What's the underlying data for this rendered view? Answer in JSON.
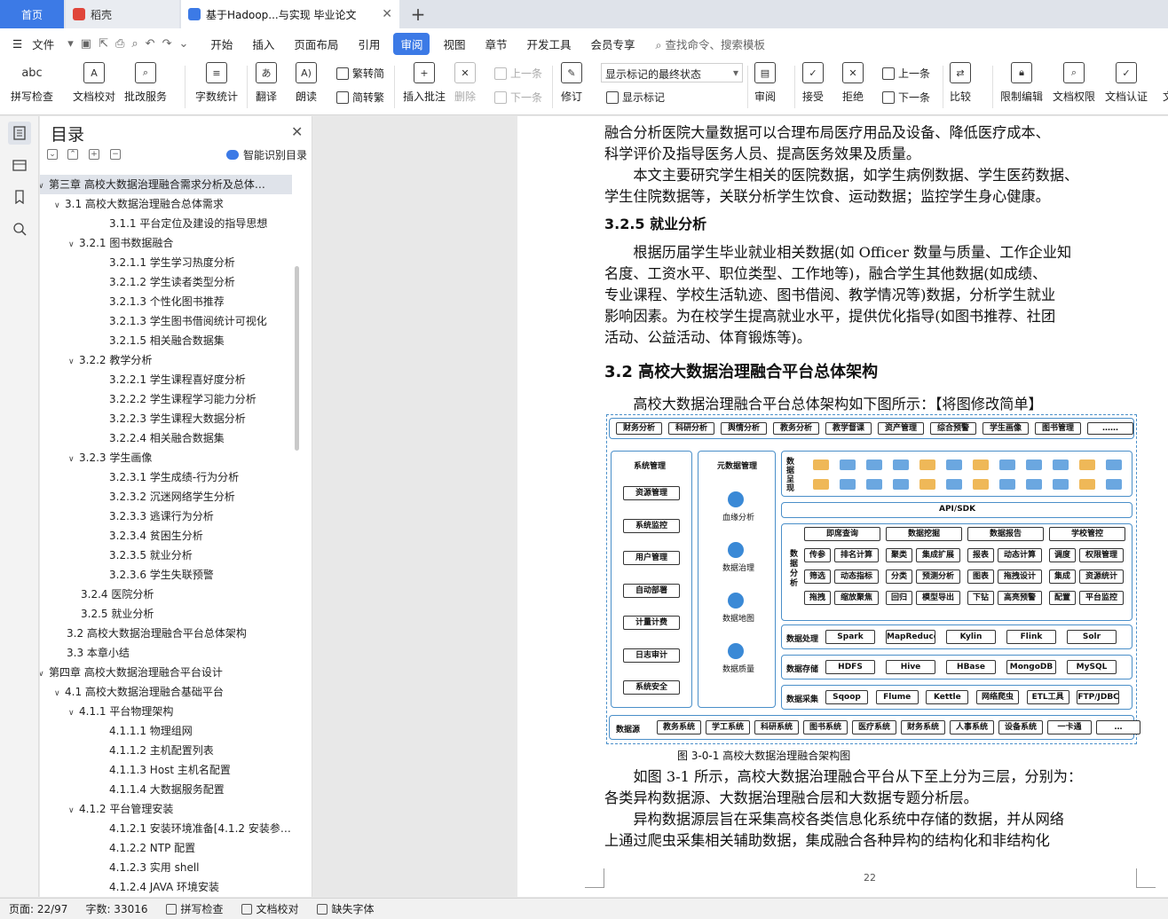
{
  "tabs": {
    "home": "首页",
    "daoke": "稻壳",
    "doc": "基于Hadoop...与实现 毕业论文"
  },
  "menu": {
    "file": "文件",
    "items": [
      "开始",
      "插入",
      "页面布局",
      "引用",
      "审阅",
      "视图",
      "章节",
      "开发工具",
      "会员专享"
    ],
    "active": "审阅",
    "search": "查找命令、搜索模板"
  },
  "ribbon": {
    "spellcheck": "拼写检查",
    "doccheck": "文档校对",
    "batch": "批改服务",
    "wordcount": "字数统计",
    "translate": "翻译",
    "read": "朗读",
    "to_trad": "繁转简",
    "to_simp": "简转繁",
    "insert_comment": "插入批注",
    "delete": "删除",
    "prev_comment": "上一条",
    "next_comment": "下一条",
    "revise": "修订",
    "markup_mode": "显示标记的最终状态",
    "show_markup": "显示标记",
    "review": "审阅",
    "accept": "接受",
    "reject": "拒绝",
    "prev": "上一条",
    "next": "下一条",
    "compare": "比较",
    "restrict": "限制编辑",
    "permission": "文档权限",
    "certify": "文档认证",
    "more": "文"
  },
  "toc": {
    "title": "目录",
    "smart": "智能识别目录",
    "items": [
      {
        "text": "第三章  高校大数据治理融合需求分析及总体…",
        "level": 0,
        "arrow": "∨"
      },
      {
        "text": "3.1  高校大数据治理融合总体需求",
        "level": 1,
        "arrow": "∨"
      },
      {
        "text": "3.1.1  平台定位及建设的指导思想",
        "level": 3,
        "arrow": ""
      },
      {
        "text": "3.2.1  图书数据融合",
        "level": 2,
        "arrow": "∨"
      },
      {
        "text": "3.2.1.1 学生学习热度分析",
        "level": 3,
        "arrow": ""
      },
      {
        "text": "3.2.1.2  学生读者类型分析",
        "level": 3,
        "arrow": ""
      },
      {
        "text": "3.2.1.3  个性化图书推荐",
        "level": 3,
        "arrow": ""
      },
      {
        "text": "3.2.1.3 学生图书借阅统计可视化",
        "level": 3,
        "arrow": ""
      },
      {
        "text": "3.2.1.5 相关融合数据集",
        "level": 3,
        "arrow": ""
      },
      {
        "text": "3.2.2  教学分析",
        "level": 2,
        "arrow": "∨"
      },
      {
        "text": "3.2.2.1  学生课程喜好度分析",
        "level": 3,
        "arrow": ""
      },
      {
        "text": "3.2.2.2  学生课程学习能力分析",
        "level": 3,
        "arrow": ""
      },
      {
        "text": "3.2.2.3  学生课程大数据分析",
        "level": 3,
        "arrow": ""
      },
      {
        "text": "3.2.2.4 相关融合数据集",
        "level": 3,
        "arrow": ""
      },
      {
        "text": "3.2.3  学生画像",
        "level": 2,
        "arrow": "∨"
      },
      {
        "text": "3.2.3.1  学生成绩-行为分析",
        "level": 3,
        "arrow": ""
      },
      {
        "text": "3.2.3.2  沉迷网络学生分析",
        "level": 3,
        "arrow": ""
      },
      {
        "text": "3.2.3.3  逃课行为分析",
        "level": 3,
        "arrow": ""
      },
      {
        "text": "3.2.3.4  贫困生分析",
        "level": 3,
        "arrow": ""
      },
      {
        "text": "3.2.3.5  就业分析",
        "level": 3,
        "arrow": ""
      },
      {
        "text": "3.2.3.6  学生失联预警",
        "level": 3,
        "arrow": ""
      },
      {
        "text": "3.2.4  医院分析",
        "level": 2,
        "arrow": ""
      },
      {
        "text": "3.2.5  就业分析",
        "level": 2,
        "arrow": ""
      },
      {
        "text": "3.2  高校大数据治理融合平台总体架构",
        "level": 1,
        "arrow": ""
      },
      {
        "text": "3.3  本章小结",
        "level": 1,
        "arrow": ""
      },
      {
        "text": "第四章  高校大数据治理融合平台设计",
        "level": 0,
        "arrow": "∨"
      },
      {
        "text": "4.1  高校大数据治理融合基础平台",
        "level": 1,
        "arrow": "∨"
      },
      {
        "text": "4.1.1  平台物理架构",
        "level": 2,
        "arrow": "∨"
      },
      {
        "text": "4.1.1.1  物理组网",
        "level": 3,
        "arrow": ""
      },
      {
        "text": "4.1.1.2  主机配置列表",
        "level": 3,
        "arrow": ""
      },
      {
        "text": "4.1.1.3 Host 主机名配置",
        "level": 3,
        "arrow": ""
      },
      {
        "text": "4.1.1.4  大数据服务配置",
        "level": 3,
        "arrow": ""
      },
      {
        "text": "4.1.2  平台管理安装",
        "level": 2,
        "arrow": "∨"
      },
      {
        "text": "4.1.2.1  安装环境准备[4.1.2 安装参…",
        "level": 3,
        "arrow": ""
      },
      {
        "text": "4.1.2.2 NTP 配置",
        "level": 3,
        "arrow": ""
      },
      {
        "text": "4.1.2.3  实用 shell",
        "level": 3,
        "arrow": ""
      },
      {
        "text": "4.1.2.4 JAVA 环境安装",
        "level": 3,
        "arrow": ""
      }
    ]
  },
  "doc": {
    "lines_top": [
      "融合分析医院大量数据可以合理布局医疗用品及设备、降低医疗成本、",
      "科学评价及指导医务人员、提高医务效果及质量。",
      "　　本文主要研究学生相关的医院数据，如学生病例数据、学生医药数据、",
      "学生住院数据等，关联分析学生饮食、运动数据；监控学生身心健康。"
    ],
    "h325": "3.2.5  就业分析",
    "lines_mid": [
      "　　根据历届学生毕业就业相关数据(如 Officer 数量与质量、工作企业知",
      "名度、工资水平、职位类型、工作地等)，融合学生其他数据(如成绩、",
      "专业课程、学校生活轨迹、图书借阅、教学情况等)数据，分析学生就业",
      "影响因素。为在校学生提高就业水平，提供优化指导(如图书推荐、社团",
      "活动、公益活动、体育锻炼等)。"
    ],
    "h32": "3.2  高校大数据治理融合平台总体架构",
    "intro": "　　高校大数据治理融合平台总体架构如下图所示：【将图修改简单】",
    "caption": "图 3-0-1 高校大数据治理融合架构图",
    "lines_bottom": [
      "　　如图 3-1 所示，高校大数据治理融合平台从下至上分为三层，分别为：",
      "各类异构数据源、大数据治理融合层和大数据专题分析层。",
      "　　异构数据源层旨在采集高校各类信息化系统中存储的数据，并从网络",
      "上通过爬虫采集相关辅助数据，集成融合各种异构的结构化和非结构化"
    ],
    "page_number": "22"
  },
  "diagram": {
    "top_row": [
      "财务分析",
      "科研分析",
      "舆情分析",
      "教务分析",
      "教学督课",
      "资产管理",
      "综合预警",
      "学生画像",
      "图书管理",
      "……"
    ],
    "left_col_title": "系统管理",
    "left_col": [
      "资源管理",
      "系统监控",
      "用户管理",
      "自动部署",
      "计量计费",
      "日志审计",
      "系统安全"
    ],
    "meta_title": "元数据管理",
    "meta_items": [
      "血缘分析",
      "数据治理",
      "数据地图",
      "数据质量"
    ],
    "viz_label": "数据呈现",
    "api": "API/SDK",
    "analysis_label": "数据分析",
    "analysis_head": [
      "即席查询",
      "数据挖掘",
      "数据报告",
      "学校管控"
    ],
    "analysis_rows": [
      [
        "传参",
        "排名计算",
        "聚类",
        "集成扩展",
        "报表",
        "动态计算",
        "调度",
        "权限管理"
      ],
      [
        "筛选",
        "动态指标",
        "分类",
        "预测分析",
        "图表",
        "拖拽设计",
        "集成",
        "资源统计"
      ],
      [
        "拖拽",
        "缩放聚焦",
        "回归",
        "模型导出",
        "下钻",
        "高亮预警",
        "配置",
        "平台监控"
      ]
    ],
    "process_label": "数据处理",
    "process": [
      "Spark",
      "MapReduce",
      "Kylin",
      "Flink",
      "Solr"
    ],
    "storage_label": "数据存储",
    "storage": [
      "HDFS",
      "Hive",
      "HBase",
      "MongoDB",
      "MySQL"
    ],
    "collect_label": "数据采集",
    "collect": [
      "Sqoop",
      "Flume",
      "Kettle",
      "网络爬虫",
      "ETL工具",
      "FTP/JDBC"
    ],
    "source_label": "数据源",
    "source": [
      "教务系统",
      "学工系统",
      "科研系统",
      "图书系统",
      "医疗系统",
      "财务系统",
      "人事系统",
      "设备系统",
      "一卡通",
      "…"
    ]
  },
  "status": {
    "page": "页面: 22/97",
    "words": "字数: 33016",
    "spell": "拼写检查",
    "proof": "文档校对",
    "font": "缺失字体"
  },
  "colors": {
    "accent": "#3c7ae6",
    "diagram": "#4a8fc9"
  }
}
